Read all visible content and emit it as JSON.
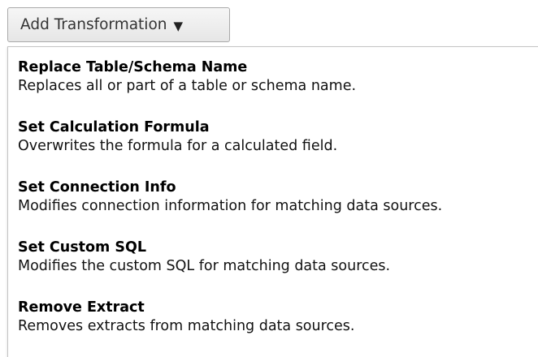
{
  "add_transformation": {
    "label": "Add Transformation",
    "caret_icon": "caret-down-icon"
  },
  "menu": {
    "items": [
      {
        "title": "Replace Table/Schema Name",
        "description": "Replaces all or part of a table or schema name."
      },
      {
        "title": "Set Calculation Formula",
        "description": "Overwrites the formula for a calculated field."
      },
      {
        "title": "Set Connection Info",
        "description": "Modifies connection information for matching data sources."
      },
      {
        "title": "Set Custom SQL",
        "description": "Modifies the custom SQL for matching data sources."
      },
      {
        "title": "Remove Extract",
        "description": "Removes extracts from matching data sources."
      }
    ]
  }
}
